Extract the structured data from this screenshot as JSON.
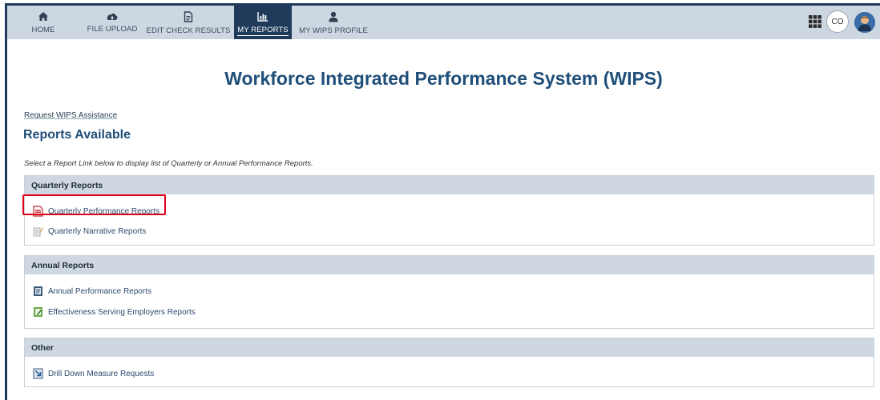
{
  "nav": {
    "items": [
      {
        "label": "HOME",
        "icon": "home-icon"
      },
      {
        "label": "FILE UPLOAD",
        "icon": "cloud-upload-icon"
      },
      {
        "label": "EDIT CHECK RESULTS",
        "icon": "document-icon"
      },
      {
        "label": "MY REPORTS",
        "icon": "bar-chart-icon",
        "active": true
      },
      {
        "label": "MY WIPS PROFILE",
        "icon": "user-icon"
      }
    ],
    "user_initials": "CO"
  },
  "page": {
    "title": "Workforce Integrated Performance System (WIPS)",
    "assist_link": "Request WIPS Assistance",
    "heading": "Reports Available",
    "instructions": "Select a Report Link below to display list of Quarterly or Annual Performance Reports."
  },
  "sections": [
    {
      "title": "Quarterly Reports",
      "links": [
        {
          "label": "Quarterly Performance Reports",
          "icon": "pdf-report-icon",
          "highlighted": true
        },
        {
          "label": "Quarterly Narrative Reports",
          "icon": "narrative-report-icon"
        }
      ]
    },
    {
      "title": "Annual Reports",
      "links": [
        {
          "label": "Annual Performance Reports",
          "icon": "annual-report-icon"
        },
        {
          "label": "Effectiveness Serving Employers Reports",
          "icon": "edit-report-icon"
        }
      ]
    },
    {
      "title": "Other",
      "links": [
        {
          "label": "Drill Down Measure Requests",
          "icon": "drill-down-icon"
        }
      ]
    }
  ],
  "colors": {
    "topbar": "#cdd7e2",
    "active_tab": "#1f3a5a",
    "title": "#1f4e79",
    "highlight": "#e0001a"
  }
}
